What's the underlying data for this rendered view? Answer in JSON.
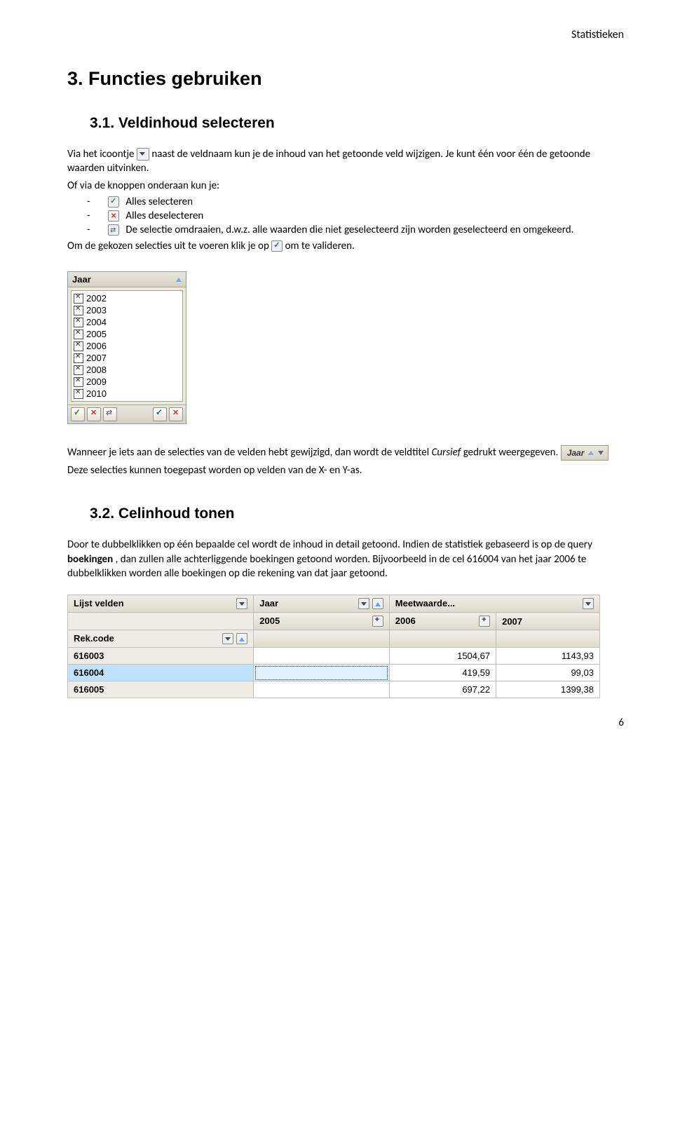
{
  "header": {
    "title": "Statistieken"
  },
  "section3": {
    "heading": "3. Functies gebruiken",
    "sub31": {
      "heading": "3.1. Veldinhoud selecteren",
      "p1a": "Via het icoontje ",
      "p1b": " naast de veldnaam kun je de inhoud van het getoonde veld wijzigen. Je kunt één voor één de getoonde waarden uitvinken.",
      "p2": "Of via de knoppen onderaan kun je:",
      "li1": "Alles selecteren",
      "li2": "Alles deselecteren",
      "li3": "De selectie omdraaien, d.w.z. alle waarden die niet geselecteerd zijn worden geselecteerd en omgekeerd.",
      "p3a": "Om de gekozen selecties uit te voeren klik je op ",
      "p3b": " om te valideren.",
      "jaar_header": "Jaar",
      "jaar_items": [
        "2002",
        "2003",
        "2004",
        "2005",
        "2006",
        "2007",
        "2008",
        "2009",
        "2010"
      ],
      "p4a": "Wanneer je iets aan de selecties van de velden hebt gewijzigd, dan wordt de veldtitel ",
      "p4_italic": "Cursief",
      "p4b": " gedrukt weergegeven. ",
      "strip_label": "Jaar",
      "p5": "Deze selecties kunnen toegepast worden op velden van de X- en Y-as."
    },
    "sub32": {
      "heading": "3.2. Celinhoud tonen",
      "p1a": "Door te dubbelklikken op één bepaalde cel wordt de inhoud in detail getoond. Indien de statistiek gebaseerd is op de query ",
      "p1_bold": "boekingen",
      "p1b": ", dan zullen alle achterliggende boekingen getoond worden. Bijvoorbeeld in de cel 616004 van het jaar 2006 te dubbelklikken worden alle boekingen op die rekening van dat jaar getoond.",
      "table": {
        "corner": "Lijst velden",
        "group_col": "Jaar",
        "value_col": "Meetwaarde...",
        "years": [
          "2005",
          "2006",
          "2007"
        ],
        "row_header": "Rek.code",
        "rows": [
          {
            "code": "616003",
            "vals": [
              "",
              "1504,67",
              "1143,93"
            ]
          },
          {
            "code": "616004",
            "vals": [
              "",
              "419,59",
              "99,03"
            ],
            "selected": true
          },
          {
            "code": "616005",
            "vals": [
              "",
              "697,22",
              "1399,38"
            ]
          }
        ]
      }
    }
  },
  "page_number": "6"
}
